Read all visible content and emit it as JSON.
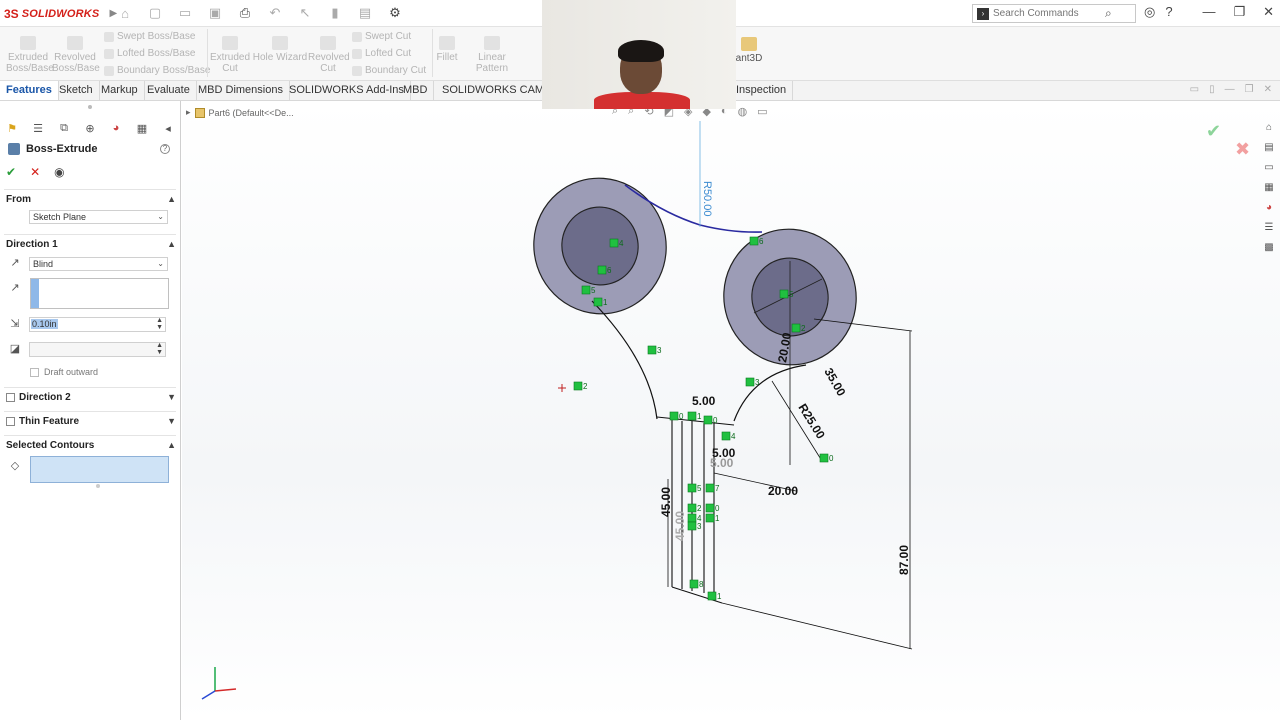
{
  "app": {
    "logo_ds": "3S",
    "logo_name": "SOLIDWORKS"
  },
  "search": {
    "placeholder": "Search Commands"
  },
  "ribbon": {
    "extruded_boss": "Extruded Boss/Base",
    "revolved_boss": "Revolved Boss/Base",
    "swept_boss": "Swept Boss/Base",
    "lofted_boss": "Lofted Boss/Base",
    "boundary_boss": "Boundary Boss/Base",
    "extruded_cut": "Extruded Cut",
    "hole_wizard": "Hole Wizard",
    "revolved_cut": "Revolved Cut",
    "swept_cut": "Swept Cut",
    "lofted_cut": "Lofted Cut",
    "boundary_cut": "Boundary Cut",
    "fillet": "Fillet",
    "linear_pattern": "Linear Pattern",
    "instant3d": "ant3D"
  },
  "tabs": [
    "Features",
    "Sketch",
    "Markup",
    "Evaluate",
    "MBD Dimensions",
    "SOLIDWORKS Add-Ins",
    "MBD",
    "SOLIDWORKS CAM",
    "Inspection"
  ],
  "panel": {
    "title": "Boss-Extrude",
    "from_label": "From",
    "from_value": "Sketch Plane",
    "direction1_label": "Direction 1",
    "end_condition": "Blind",
    "depth": "0.10in",
    "draft_outward": "Draft outward",
    "direction2_label": "Direction 2",
    "thin_feature_label": "Thin Feature",
    "selected_contours_label": "Selected Contours"
  },
  "viewport": {
    "tree_label": "Part6  (Default<<De..."
  },
  "dimensions": {
    "r50": "R50.00",
    "d20_v": "20.00",
    "d35": "35.00",
    "r25": "R25.00",
    "d5_top": "5.00",
    "d5_mid": "5.00",
    "d5_mid2": "5.00",
    "d20_h": "20.00",
    "d45": "45.00",
    "d45_ghost": "45.00",
    "d87": "87.00"
  },
  "relations": [
    "4",
    "6",
    "5",
    "1",
    "3",
    "2",
    "6",
    "5",
    "2",
    "3",
    "0",
    "1",
    "0",
    "4",
    "5",
    "7",
    "2",
    "0",
    "4",
    "1",
    "3",
    "8",
    "1",
    "0"
  ],
  "colors": {
    "accent": "#1a56a8",
    "ok": "#2a9d3a",
    "cancel": "#d4201a",
    "part_fill": "#9c9cb6",
    "relation": "#20c040"
  }
}
